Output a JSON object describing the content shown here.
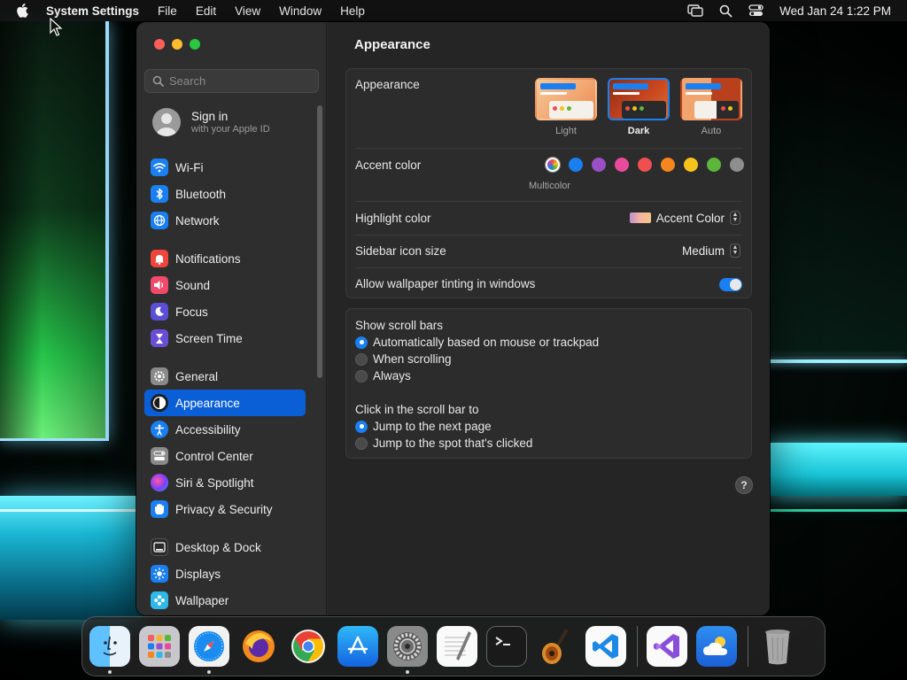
{
  "menubar": {
    "app_name": "System Settings",
    "items": [
      "File",
      "Edit",
      "View",
      "Window",
      "Help"
    ],
    "datetime": "Wed Jan 24  1:22 PM"
  },
  "window": {
    "search_placeholder": "Search",
    "signin": {
      "title": "Sign in",
      "subtitle": "with your Apple ID"
    },
    "sidebar_groups": [
      [
        {
          "label": "Wi-Fi",
          "icon": "wifi-icon",
          "color": "#1a7ff0"
        },
        {
          "label": "Bluetooth",
          "icon": "bluetooth-icon",
          "color": "#1a7ff0"
        },
        {
          "label": "Network",
          "icon": "globe-icon",
          "color": "#1a7ff0"
        }
      ],
      [
        {
          "label": "Notifications",
          "icon": "bell-icon",
          "color": "#f0453a"
        },
        {
          "label": "Sound",
          "icon": "speaker-icon",
          "color": "#f04a6a"
        },
        {
          "label": "Focus",
          "icon": "moon-icon",
          "color": "#5a4fd6"
        },
        {
          "label": "Screen Time",
          "icon": "hourglass-icon",
          "color": "#6a4fd6"
        }
      ],
      [
        {
          "label": "General",
          "icon": "gear-icon",
          "color": "#8a8a8a"
        },
        {
          "label": "Appearance",
          "icon": "appearance-icon",
          "color": "#1c1c1c",
          "selected": true
        },
        {
          "label": "Accessibility",
          "icon": "accessibility-icon",
          "color": "#1a7ff0"
        },
        {
          "label": "Control Center",
          "icon": "control-center-icon",
          "color": "#8a8a8a"
        },
        {
          "label": "Siri & Spotlight",
          "icon": "siri-icon",
          "color": "#b04ad8"
        },
        {
          "label": "Privacy & Security",
          "icon": "hand-icon",
          "color": "#1a7ff0"
        }
      ],
      [
        {
          "label": "Desktop & Dock",
          "icon": "dock-icon",
          "color": "#2a2a2a"
        },
        {
          "label": "Displays",
          "icon": "sun-icon",
          "color": "#1a7ff0"
        },
        {
          "label": "Wallpaper",
          "icon": "wallpaper-icon",
          "color": "#2fb8e8"
        }
      ]
    ]
  },
  "content": {
    "title": "Appearance",
    "appearance": {
      "label": "Appearance",
      "options": [
        {
          "caption": "Light",
          "selected": false
        },
        {
          "caption": "Dark",
          "selected": true
        },
        {
          "caption": "Auto",
          "selected": false
        }
      ]
    },
    "accent": {
      "label": "Accent color",
      "caption": "Multicolor",
      "colors": [
        "multicolor",
        "#1a7ff0",
        "#9b4fc4",
        "#e94b9b",
        "#ef4f4f",
        "#f5861f",
        "#f7c21b",
        "#5db63c",
        "#8e8e8e"
      ],
      "selected_index": 0
    },
    "highlight": {
      "label": "Highlight color",
      "value": "Accent Color"
    },
    "sidebar_icon_size": {
      "label": "Sidebar icon size",
      "value": "Medium"
    },
    "wallpaper_tinting": {
      "label": "Allow wallpaper tinting in windows",
      "on": true
    },
    "scroll_bars": {
      "label": "Show scroll bars",
      "options": [
        "Automatically based on mouse or trackpad",
        "When scrolling",
        "Always"
      ],
      "selected_index": 0
    },
    "click_scroll": {
      "label": "Click in the scroll bar to",
      "options": [
        "Jump to the next page",
        "Jump to the spot that's clicked"
      ],
      "selected_index": 0
    },
    "help": "?"
  },
  "dock": {
    "apps": [
      {
        "name": "finder-app",
        "running": true
      },
      {
        "name": "launchpad-app",
        "running": false
      },
      {
        "name": "safari-app",
        "running": true
      },
      {
        "name": "firefox-app",
        "running": false
      },
      {
        "name": "chrome-app",
        "running": false
      },
      {
        "name": "app-store-app",
        "running": false
      },
      {
        "name": "system-settings-app",
        "running": true
      },
      {
        "name": "textedit-app",
        "running": false
      },
      {
        "name": "terminal-app",
        "running": false
      },
      {
        "name": "garageband-app",
        "running": false
      },
      {
        "name": "vscode-app",
        "running": false
      },
      {
        "name": "visual-studio-app",
        "running": false
      },
      {
        "name": "weather-app",
        "running": false
      },
      {
        "name": "trash",
        "running": false
      }
    ]
  }
}
